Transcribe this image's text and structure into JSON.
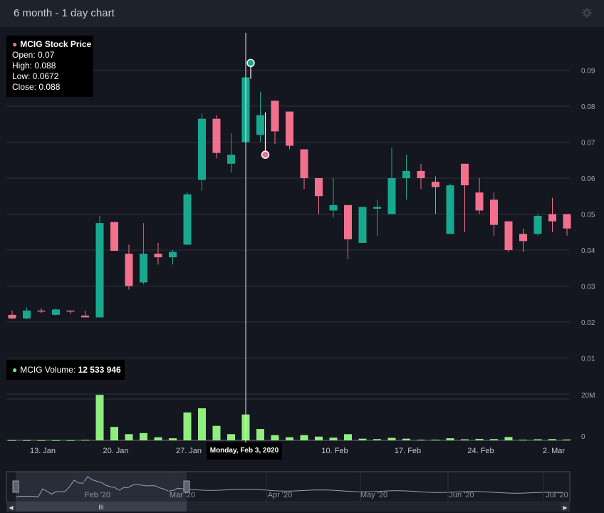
{
  "header": {
    "title": "6 month - 1 day  chart",
    "settings_icon": "gear-icon"
  },
  "price_tooltip": {
    "title": "MCIG Stock Price",
    "open": "Open: 0.07",
    "high": "High: 0.088",
    "low": "Low: 0.0672",
    "close": "Close: 0.088"
  },
  "volume_tooltip": {
    "label": "MCIG Volume: ",
    "value": "12 533 946"
  },
  "crosshair_label": "Monday, Feb 3, 2020",
  "colors": {
    "up": "#17a98f",
    "down": "#f2708e",
    "volume": "#90ee7e",
    "grid": "#2c313d",
    "background": "#14171f"
  },
  "chart_data": {
    "type": "candlestick",
    "series": [
      {
        "name": "MCIG Stock Price",
        "ohlc": [
          {
            "o": 0.022,
            "h": 0.0232,
            "l": 0.0208,
            "c": 0.021
          },
          {
            "o": 0.021,
            "h": 0.024,
            "l": 0.0208,
            "c": 0.0232
          },
          {
            "o": 0.0232,
            "h": 0.0238,
            "l": 0.0225,
            "c": 0.023
          },
          {
            "o": 0.022,
            "h": 0.0238,
            "l": 0.0218,
            "c": 0.0235
          },
          {
            "o": 0.0232,
            "h": 0.0232,
            "l": 0.0222,
            "c": 0.023
          },
          {
            "o": 0.0218,
            "h": 0.0232,
            "l": 0.0215,
            "c": 0.0213
          },
          {
            "o": 0.0213,
            "h": 0.0495,
            "l": 0.0213,
            "c": 0.0475
          },
          {
            "o": 0.0478,
            "h": 0.0478,
            "l": 0.04,
            "c": 0.0398
          },
          {
            "o": 0.039,
            "h": 0.0415,
            "l": 0.029,
            "c": 0.03
          },
          {
            "o": 0.031,
            "h": 0.0475,
            "l": 0.0305,
            "c": 0.039
          },
          {
            "o": 0.039,
            "h": 0.042,
            "l": 0.036,
            "c": 0.038
          },
          {
            "o": 0.038,
            "h": 0.04,
            "l": 0.036,
            "c": 0.0395
          },
          {
            "o": 0.0415,
            "h": 0.056,
            "l": 0.0415,
            "c": 0.0555
          },
          {
            "o": 0.0595,
            "h": 0.078,
            "l": 0.0565,
            "c": 0.0765
          },
          {
            "o": 0.0765,
            "h": 0.0775,
            "l": 0.0655,
            "c": 0.067
          },
          {
            "o": 0.064,
            "h": 0.0725,
            "l": 0.0615,
            "c": 0.0665
          },
          {
            "o": 0.07,
            "h": 0.092,
            "l": 0.0665,
            "c": 0.088
          },
          {
            "o": 0.072,
            "h": 0.084,
            "l": 0.07,
            "c": 0.0775
          },
          {
            "o": 0.0815,
            "h": 0.0815,
            "l": 0.0695,
            "c": 0.073
          },
          {
            "o": 0.0785,
            "h": 0.0785,
            "l": 0.068,
            "c": 0.069
          },
          {
            "o": 0.068,
            "h": 0.068,
            "l": 0.057,
            "c": 0.06
          },
          {
            "o": 0.06,
            "h": 0.06,
            "l": 0.05,
            "c": 0.055
          },
          {
            "o": 0.051,
            "h": 0.06,
            "l": 0.049,
            "c": 0.0525
          },
          {
            "o": 0.0525,
            "h": 0.0525,
            "l": 0.0375,
            "c": 0.043
          },
          {
            "o": 0.042,
            "h": 0.052,
            "l": 0.042,
            "c": 0.052
          },
          {
            "o": 0.0515,
            "h": 0.054,
            "l": 0.044,
            "c": 0.052
          },
          {
            "o": 0.05,
            "h": 0.0685,
            "l": 0.05,
            "c": 0.06
          },
          {
            "o": 0.06,
            "h": 0.0665,
            "l": 0.054,
            "c": 0.062
          },
          {
            "o": 0.062,
            "h": 0.064,
            "l": 0.057,
            "c": 0.06
          },
          {
            "o": 0.059,
            "h": 0.0605,
            "l": 0.05,
            "c": 0.0575
          },
          {
            "o": 0.0445,
            "h": 0.0585,
            "l": 0.0445,
            "c": 0.058
          },
          {
            "o": 0.064,
            "h": 0.064,
            "l": 0.045,
            "c": 0.058
          },
          {
            "o": 0.056,
            "h": 0.06,
            "l": 0.05,
            "c": 0.051
          },
          {
            "o": 0.054,
            "h": 0.056,
            "l": 0.044,
            "c": 0.047
          },
          {
            "o": 0.048,
            "h": 0.048,
            "l": 0.0395,
            "c": 0.04
          },
          {
            "o": 0.0445,
            "h": 0.046,
            "l": 0.0395,
            "c": 0.0425
          },
          {
            "o": 0.0445,
            "h": 0.05,
            "l": 0.044,
            "c": 0.0495
          },
          {
            "o": 0.05,
            "h": 0.0545,
            "l": 0.045,
            "c": 0.048
          },
          {
            "o": 0.05,
            "h": 0.05,
            "l": 0.044,
            "c": 0.046
          }
        ]
      },
      {
        "name": "MCIG Volume",
        "values": [
          0.1,
          0.1,
          0.1,
          0.1,
          0.1,
          0.2,
          22.0,
          6.5,
          3.0,
          3.5,
          1.5,
          1.0,
          13.5,
          15.5,
          7.0,
          3.0,
          12.5,
          5.5,
          2.5,
          1.5,
          2.5,
          1.8,
          1.3,
          3.0,
          0.8,
          0.6,
          1.2,
          0.8,
          0.3,
          0.3,
          1.0,
          0.5,
          0.7,
          0.6,
          1.6,
          0.3,
          0.5,
          0.6,
          0.4
        ]
      }
    ],
    "x_tick_labels": [
      "13. Jan",
      "20. Jan",
      "27. Jan",
      "10. Feb",
      "17. Feb",
      "24. Feb",
      "2. Mar"
    ],
    "y_tick_labels": [
      "0.09",
      "0.08",
      "0.07",
      "0.06",
      "0.05",
      "0.04",
      "0.03",
      "0.02",
      "0.01"
    ],
    "volume_tick_labels": [
      "20M",
      "0"
    ],
    "price_ylim": [
      0.0,
      0.1
    ],
    "volume_ylim": [
      0,
      20
    ],
    "highlighted_index": 16,
    "navigator": {
      "x_tick_labels": [
        "Feb '20",
        "Mar '20",
        "Apr '20",
        "May '20",
        "Jun '20",
        "Jul '20"
      ],
      "scroll_handle": "III"
    }
  }
}
